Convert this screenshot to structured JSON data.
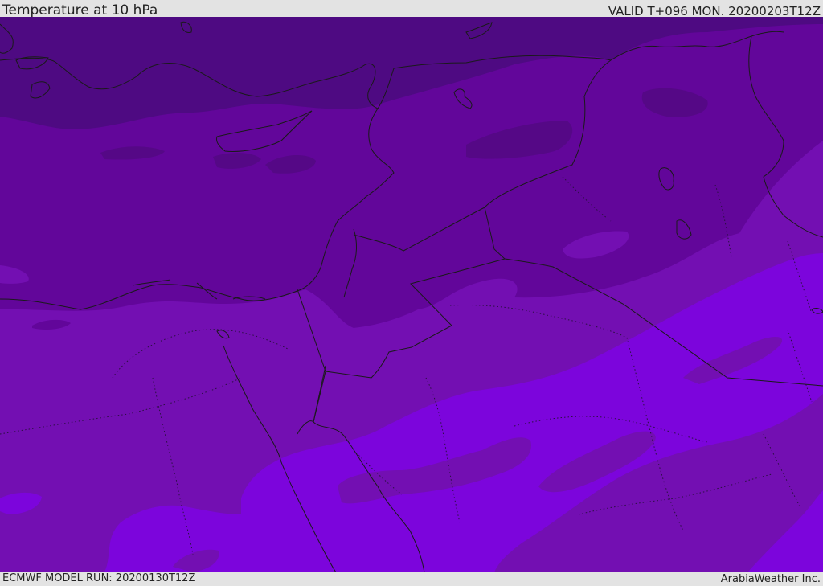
{
  "header": {
    "title": "Temperature at 10 hPa",
    "valid_time": "VALID T+096 MON. 20200203T12Z"
  },
  "footer": {
    "model_run": "ECMWF MODEL RUN: 20200130T12Z",
    "credit": "ArabiaWeather Inc."
  },
  "map": {
    "colors": {
      "band_darkest": "#4e0a82",
      "band_dark": "#62069a",
      "band_mid": "#730fb2",
      "band_light": "#7c05dc",
      "coastline": "#1a1a1a",
      "border": "#1a1a1a"
    }
  }
}
